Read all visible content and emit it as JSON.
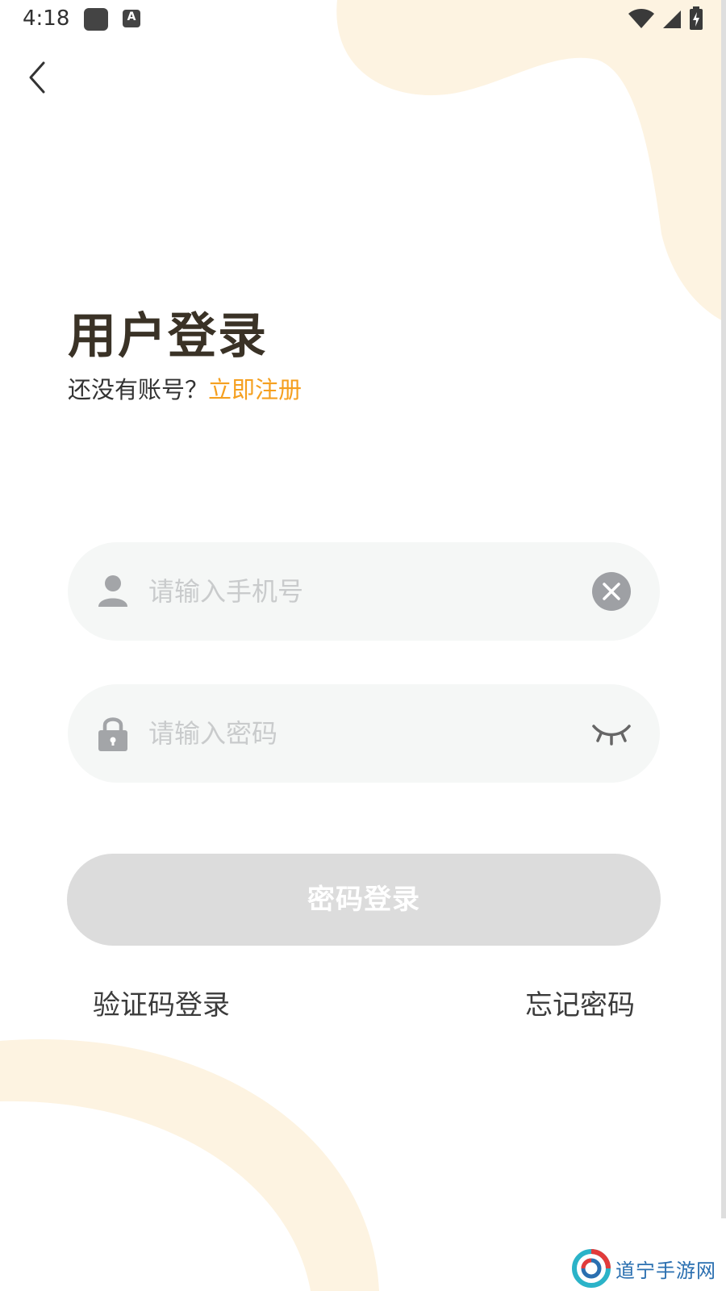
{
  "status_bar": {
    "time": "4:18",
    "app_icon_1": "square-app-icon",
    "app_icon_2": "a-box-icon",
    "wifi": "wifi-icon",
    "signal": "signal-icon",
    "battery": "battery-charging-icon",
    "app_icon_2_letter": "A"
  },
  "nav": {
    "back_icon": "chevron-left-icon"
  },
  "header": {
    "title": "用户登录",
    "prompt": "还没有账号？",
    "register_link": "立即注册"
  },
  "form": {
    "phone": {
      "placeholder": "请输入手机号",
      "value": "",
      "icon": "user-icon",
      "clear_icon": "close-circle-icon"
    },
    "password": {
      "placeholder": "请输入密码",
      "value": "",
      "icon": "lock-icon",
      "toggle_icon": "eye-closed-icon"
    },
    "submit_label": "密码登录"
  },
  "links": {
    "sms_login": "验证码登录",
    "forgot_password": "忘记密码"
  },
  "watermark": {
    "text": "道宁手游网",
    "logo_icon": "swirl-logo-icon"
  },
  "colors": {
    "accent": "#f5a020",
    "title": "#3a3226",
    "input_bg": "#f5f7f6",
    "button_disabled": "#dcdcdc",
    "decor": "#fdf3e1"
  }
}
